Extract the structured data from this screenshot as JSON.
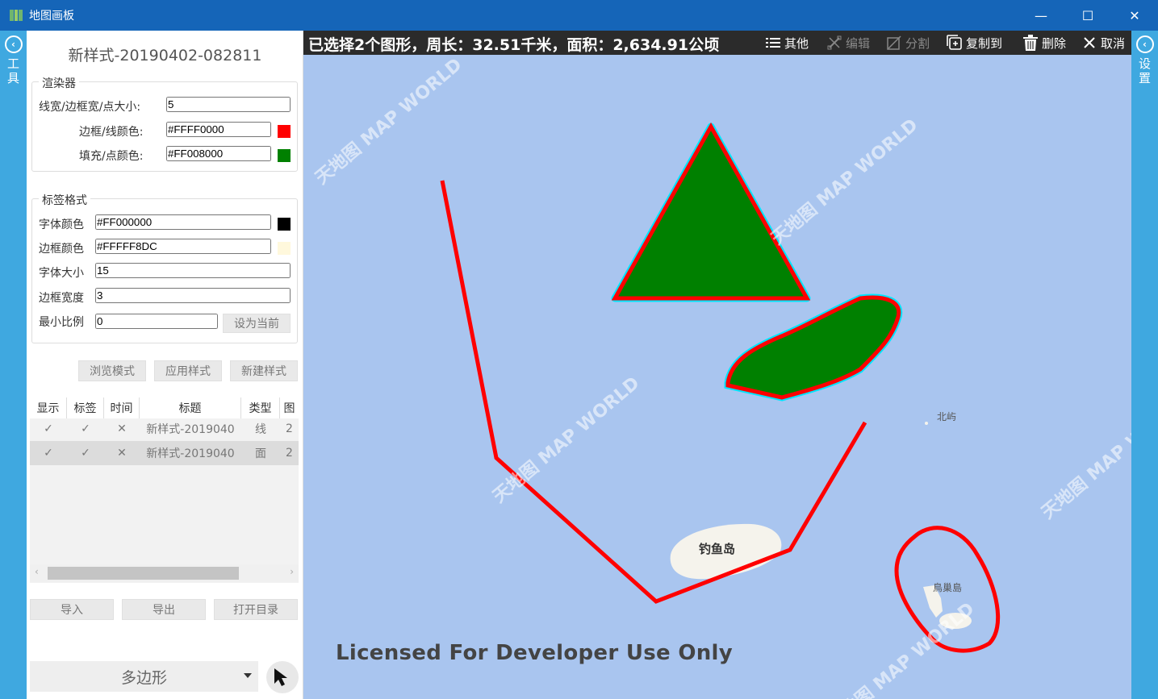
{
  "window": {
    "title": "地图画板",
    "minimize": "—",
    "maximize": "☐",
    "close": "✕"
  },
  "left_rail": {
    "label": "工具",
    "icon": "chevron-left-icon"
  },
  "right_rail": {
    "label": "设置",
    "icon": "chevron-left-icon"
  },
  "style": {
    "title": "新样式-20190402-082811"
  },
  "renderer": {
    "legend": "渲染器",
    "line_width_label": "线宽/边框宽/点大小:",
    "line_width_value": "5",
    "border_color_label": "边框/线颜色:",
    "border_color_value": "#FFFF0000",
    "border_color": "#ff0000",
    "fill_color_label": "填充/点颜色:",
    "fill_color_value": "#FF008000",
    "fill_color": "#008000"
  },
  "label_format": {
    "legend": "标签格式",
    "font_color_label": "字体颜色",
    "font_color_value": "#FF000000",
    "font_color": "#000000",
    "border_color_label": "边框颜色",
    "border_color_value": "#FFFFF8DC",
    "border_color": "#fff8dc",
    "font_size_label": "字体大小",
    "font_size_value": "15",
    "border_width_label": "边框宽度",
    "border_width_value": "3",
    "min_scale_label": "最小比例",
    "min_scale_value": "0",
    "set_current_button": "设为当前"
  },
  "actions": {
    "browse": "浏览模式",
    "apply": "应用样式",
    "new": "新建样式"
  },
  "table": {
    "headers": [
      "显示",
      "标签",
      "时间",
      "标题",
      "类型",
      "图"
    ],
    "rows": [
      {
        "show": "✓",
        "label": "✓",
        "time": "✕",
        "title": "新样式-2019040",
        "type": "线",
        "extra": "2",
        "selected": false
      },
      {
        "show": "✓",
        "label": "✓",
        "time": "✕",
        "title": "新样式-2019040",
        "type": "面",
        "extra": "2",
        "selected": true
      }
    ],
    "scroll_left": "‹",
    "scroll_right": "›"
  },
  "io": {
    "import": "导入",
    "export": "导出",
    "open_dir": "打开目录"
  },
  "shape_select": {
    "value": "多边形"
  },
  "map_toolbar": {
    "summary": "已选择2个图形，周长：32.51千米，面积：2,634.91公顷",
    "others": "其他",
    "edit": "编辑",
    "split": "分割",
    "copy_to": "复制到",
    "delete": "删除",
    "cancel": "取消"
  },
  "map": {
    "islands": {
      "diaoyu": "钓鱼岛",
      "niaochao": "鳥巢島",
      "beiyu": "北屿"
    },
    "license": "Licensed For Developer Use Only",
    "watermark": "天地图 MAP WORLD",
    "water_color": "#a9c5ef",
    "stroke_color": "#ff0000",
    "fill_color": "#008000",
    "halo_color": "#00e5ff"
  }
}
